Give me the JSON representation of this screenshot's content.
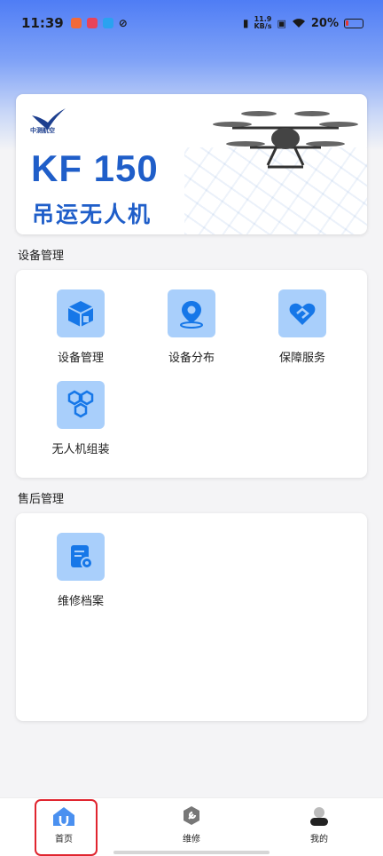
{
  "status_bar": {
    "time": "11:39",
    "net_speed_value": "11.9",
    "net_speed_unit": "KB/s",
    "battery": "20%",
    "battery_level": 0.2
  },
  "banner": {
    "logo_text": "中测航空",
    "model": "KF 150",
    "subtitle": "吊运无人机"
  },
  "sections": {
    "device": {
      "title": "设备管理",
      "tiles": [
        {
          "label": "设备管理",
          "icon": "box-icon"
        },
        {
          "label": "设备分布",
          "icon": "location-pin-icon"
        },
        {
          "label": "保障服务",
          "icon": "heart-shield-icon"
        },
        {
          "label": "无人机组装",
          "icon": "hexagons-icon"
        }
      ]
    },
    "after_sales": {
      "title": "售后管理",
      "tiles": [
        {
          "label": "维修档案",
          "icon": "document-gear-icon"
        }
      ]
    }
  },
  "bottom_nav": {
    "items": [
      {
        "label": "首页",
        "icon": "home-icon",
        "active": true
      },
      {
        "label": "维修",
        "icon": "wrench-icon",
        "active": false
      },
      {
        "label": "我的",
        "icon": "user-icon",
        "active": false
      }
    ]
  },
  "colors": {
    "accent": "#1f5ec9",
    "tile_icon_bg": "#a9cffb",
    "tile_icon_fg": "#1677e8",
    "highlight": "#e0252f"
  }
}
